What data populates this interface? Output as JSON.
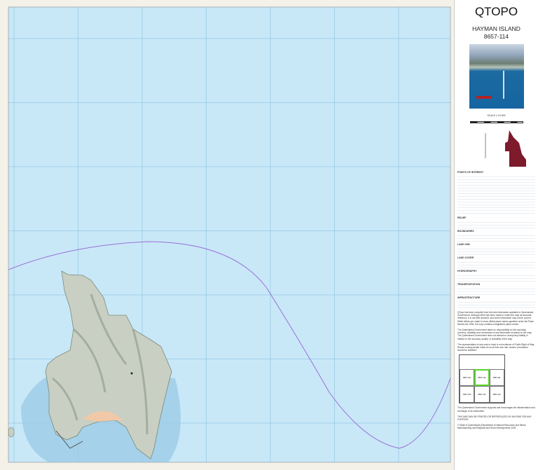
{
  "panel": {
    "title": "QTOPO",
    "map_name": "HAYMAN ISLAND",
    "sheet_number": "8657-114",
    "scale_text": "SCALE 1:10,000",
    "legend_sections": [
      "POINTS OF INTEREST",
      "RELIEF",
      "BOUNDARIES",
      "LAND USE",
      "LAND COVER",
      "HYDROGRAPHY",
      "TRANSPORTATION",
      "INFRASTRUCTURE"
    ],
    "disclaimer": [
      "QTopo has been compiled from the best information available to Queensland Government. Although effort has been made to model the map as accurate reference, it is not field checked, and some information may not be current. While efforts are made to show official place names gazetted under the Place Names Act 1994, the map contains unregistered place names.",
      "The Queensland Government takes no responsibility for the accuracy, currency, reliability and correctness of any information included on the map. The Queensland Government does not warrant or accept any liability in relation to the accuracy, quality, or suitability of the map.",
      "The representation of any road or track is not evidence of Public Right of Way. Roads running private roads do so at their own risk; owners' permission should be obtained."
    ],
    "adjacent_sheets": [
      "8657-141",
      "8657-114",
      "8657-111",
      "8657-143",
      "8657-113",
      "8657-112"
    ],
    "adjacent_current": "8657-114",
    "footer_note": "The Queensland Government supports and encourages the dissemination and exchange of its information.",
    "not_for_navigation": "THIS MAP MAY BE PRINTED OR REPRODUCED BY ANYONE FOR ANY PURPOSE.",
    "copyright": "© State of Queensland (Department of Natural Resources and Mines, Manufacturing and Regional and Rural Development) 2025"
  },
  "colors": {
    "sea": "#c8e8f8",
    "shallow": "#9ccbe6",
    "boundary": "#9b6fd6",
    "grid": "#7fb6d6",
    "locator": "#7d1a2c"
  }
}
